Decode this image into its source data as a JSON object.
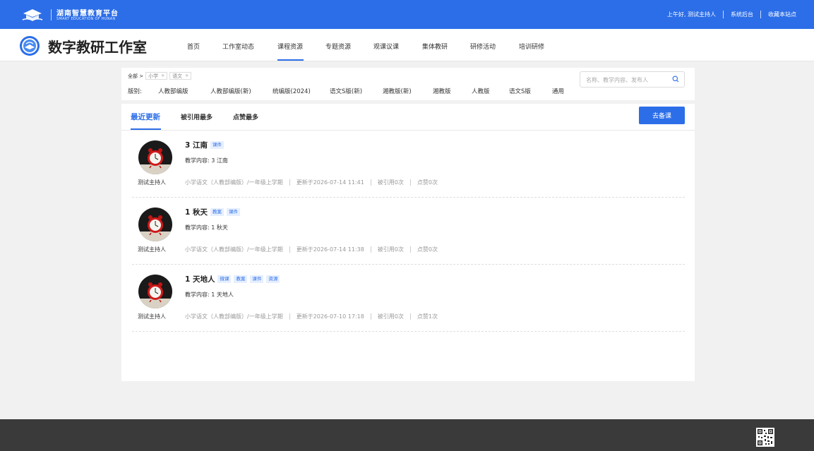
{
  "topbar": {
    "brand_cn": "湖南智慧教育平台",
    "brand_en": "SMART EDUCATION OF HUNAN",
    "greeting": "上午好, 测试主持人",
    "admin_link": "系统后台",
    "bookmark_link": "收藏本站点"
  },
  "header": {
    "studio_title": "数字教研工作室",
    "nav": [
      "首页",
      "工作室动态",
      "课程资源",
      "专题资源",
      "观课议课",
      "集体教研",
      "研修活动",
      "培训研修"
    ],
    "active_nav": "课程资源"
  },
  "filter": {
    "all_label": "全部 >",
    "tags": [
      "小学",
      "语文"
    ],
    "edition_label": "版别:",
    "editions": [
      "人教部编版",
      "人教部编版(新)",
      "统编版(2024)",
      "语文S版(新)",
      "湘教版(新)",
      "湘教版",
      "人教版",
      "语文S版",
      "通用"
    ],
    "search_placeholder": "名称、教学内容、发布人"
  },
  "main": {
    "tabs": [
      "最近更新",
      "被引用最多",
      "点赞最多"
    ],
    "active_tab": "最近更新",
    "prep_button": "去备课",
    "items": [
      {
        "title": "3 江南",
        "badges": [
          "课件"
        ],
        "content": "教学内容: 3 江南",
        "author": "测试主持人",
        "subject": "小学语文（人教部编版）/一年级上学期",
        "updated": "更新于2026-07-14 11:41",
        "cited": "被引用0次",
        "likes": "点赞0次"
      },
      {
        "title": "1 秋天",
        "badges": [
          "教案",
          "课件"
        ],
        "content": "教学内容: 1 秋天",
        "author": "测试主持人",
        "subject": "小学语文（人教部编版）/一年级上学期",
        "updated": "更新于2026-07-14 11:38",
        "cited": "被引用0次",
        "likes": "点赞0次"
      },
      {
        "title": "1 天地人",
        "badges": [
          "微课",
          "教案",
          "课件",
          "资源"
        ],
        "content": "教学内容: 1 天地人",
        "author": "测试主持人",
        "subject": "小学语文（人教部编版）/一年级上学期",
        "updated": "更新于2026-07-10 17:18",
        "cited": "被引用0次",
        "likes": "点赞1次"
      }
    ]
  },
  "colors": {
    "primary": "#2c6ee8",
    "badge_bg": "#e6efff",
    "footer": "#3a3a3a"
  }
}
